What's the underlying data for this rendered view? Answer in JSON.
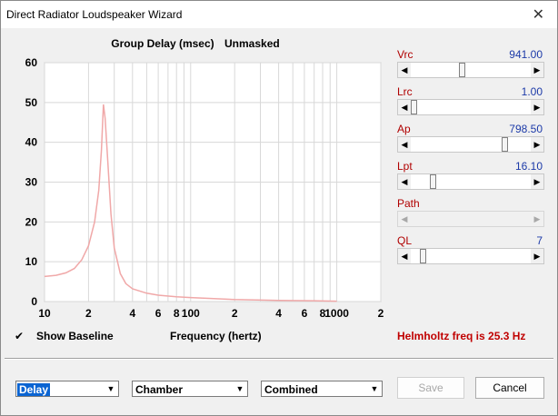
{
  "window": {
    "title": "Direct Radiator Loudspeaker Wizard",
    "close_glyph": "✕"
  },
  "chart_header": {
    "title": "Group Delay (msec)",
    "mode": "Unmasked"
  },
  "sliders": [
    {
      "label": "Vrc",
      "value": "941.00",
      "position": 0.42,
      "enabled": true
    },
    {
      "label": "Lrc",
      "value": "1.00",
      "position": 0.0,
      "enabled": true
    },
    {
      "label": "Ap",
      "value": "798.50",
      "position": 0.8,
      "enabled": true
    },
    {
      "label": "Lpt",
      "value": "16.10",
      "position": 0.17,
      "enabled": true
    },
    {
      "label": "Path",
      "value": "",
      "position": null,
      "enabled": false
    },
    {
      "label": "QL",
      "value": "7",
      "position": 0.08,
      "enabled": true
    }
  ],
  "controls": {
    "show_baseline_label": "Show Baseline",
    "show_baseline_checked": true,
    "check_glyph": "✔",
    "frequency_label": "Frequency (hertz)",
    "helmholtz": "Helmholtz freq is 25.3 Hz"
  },
  "footer": {
    "select1": "Delay",
    "select2": "Chamber",
    "select3": "Combined",
    "save_label": "Save",
    "cancel_label": "Cancel"
  },
  "colors": {
    "curve": "#f0a8a8",
    "slider_label": "#b00000",
    "slider_value": "#1c3aa8",
    "helmholtz": "#c00000"
  },
  "chart_data": {
    "type": "line",
    "title": "Group Delay (msec)",
    "xlabel": "Frequency (hertz)",
    "ylabel": "",
    "xscale": "log",
    "xlim": [
      10,
      2000
    ],
    "ylim": [
      0,
      60
    ],
    "yticks": [
      0,
      10,
      20,
      30,
      40,
      50,
      60
    ],
    "xtick_labels": [
      {
        "x": 10,
        "label": "10"
      },
      {
        "x": 20,
        "label": "2"
      },
      {
        "x": 40,
        "label": "4"
      },
      {
        "x": 60,
        "label": "6"
      },
      {
        "x": 80,
        "label": "8"
      },
      {
        "x": 100,
        "label": "100"
      },
      {
        "x": 200,
        "label": "2"
      },
      {
        "x": 400,
        "label": "4"
      },
      {
        "x": 600,
        "label": "6"
      },
      {
        "x": 800,
        "label": "8"
      },
      {
        "x": 1000,
        "label": "1000"
      },
      {
        "x": 2000,
        "label": "2"
      }
    ],
    "grid": true,
    "series": [
      {
        "values": [
          [
            10,
            6.3
          ],
          [
            12,
            6.6
          ],
          [
            14,
            7.2
          ],
          [
            16,
            8.3
          ],
          [
            18,
            10.5
          ],
          [
            20,
            14
          ],
          [
            22,
            20
          ],
          [
            23.5,
            28
          ],
          [
            24.5,
            38
          ],
          [
            25.3,
            49.5
          ],
          [
            26,
            46
          ],
          [
            27,
            36
          ],
          [
            28.5,
            22
          ],
          [
            30,
            13.5
          ],
          [
            33,
            7
          ],
          [
            36,
            4.5
          ],
          [
            40,
            3.2
          ],
          [
            50,
            2.1
          ],
          [
            60,
            1.6
          ],
          [
            80,
            1.2
          ],
          [
            100,
            1.0
          ],
          [
            150,
            0.7
          ],
          [
            200,
            0.5
          ],
          [
            400,
            0.3
          ],
          [
            700,
            0.2
          ],
          [
            1000,
            0.1
          ]
        ]
      }
    ]
  }
}
